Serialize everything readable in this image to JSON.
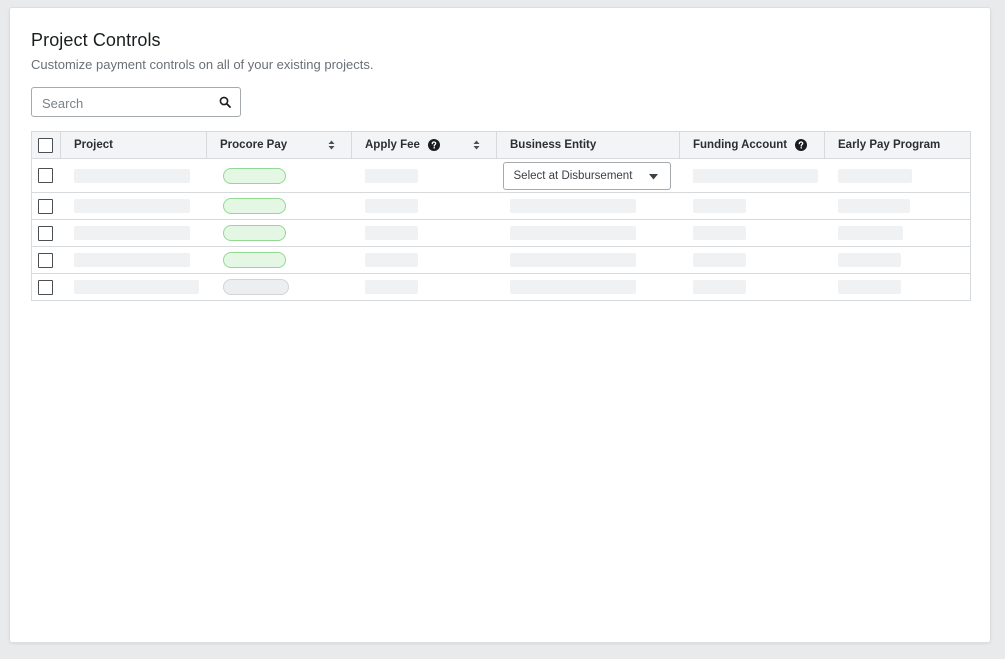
{
  "header": {
    "title": "Project Controls",
    "subtitle": "Customize payment controls on all of your existing projects."
  },
  "search": {
    "placeholder": "Search",
    "value": ""
  },
  "table": {
    "columns": [
      {
        "label": "Project",
        "sortable": false,
        "help": false
      },
      {
        "label": "Procore Pay",
        "sortable": true,
        "help": false
      },
      {
        "label": "Apply Fee",
        "sortable": true,
        "help": true
      },
      {
        "label": "Business Entity",
        "sortable": false,
        "help": false
      },
      {
        "label": "Funding Account",
        "sortable": false,
        "help": true
      },
      {
        "label": "Early Pay Program",
        "sortable": false,
        "help": false
      }
    ],
    "business_entity_select": "Select at Disbursement",
    "rows": [
      {
        "procore_pay": "on"
      },
      {
        "procore_pay": "on"
      },
      {
        "procore_pay": "on"
      },
      {
        "procore_pay": "on"
      },
      {
        "procore_pay": "off"
      }
    ]
  },
  "colors": {
    "pill_on": "#e4f7e4",
    "pill_on_border": "#93d993",
    "pill_off": "#edeef0",
    "skeleton": "#eff1f2",
    "header_bg": "#f3f4f5"
  }
}
